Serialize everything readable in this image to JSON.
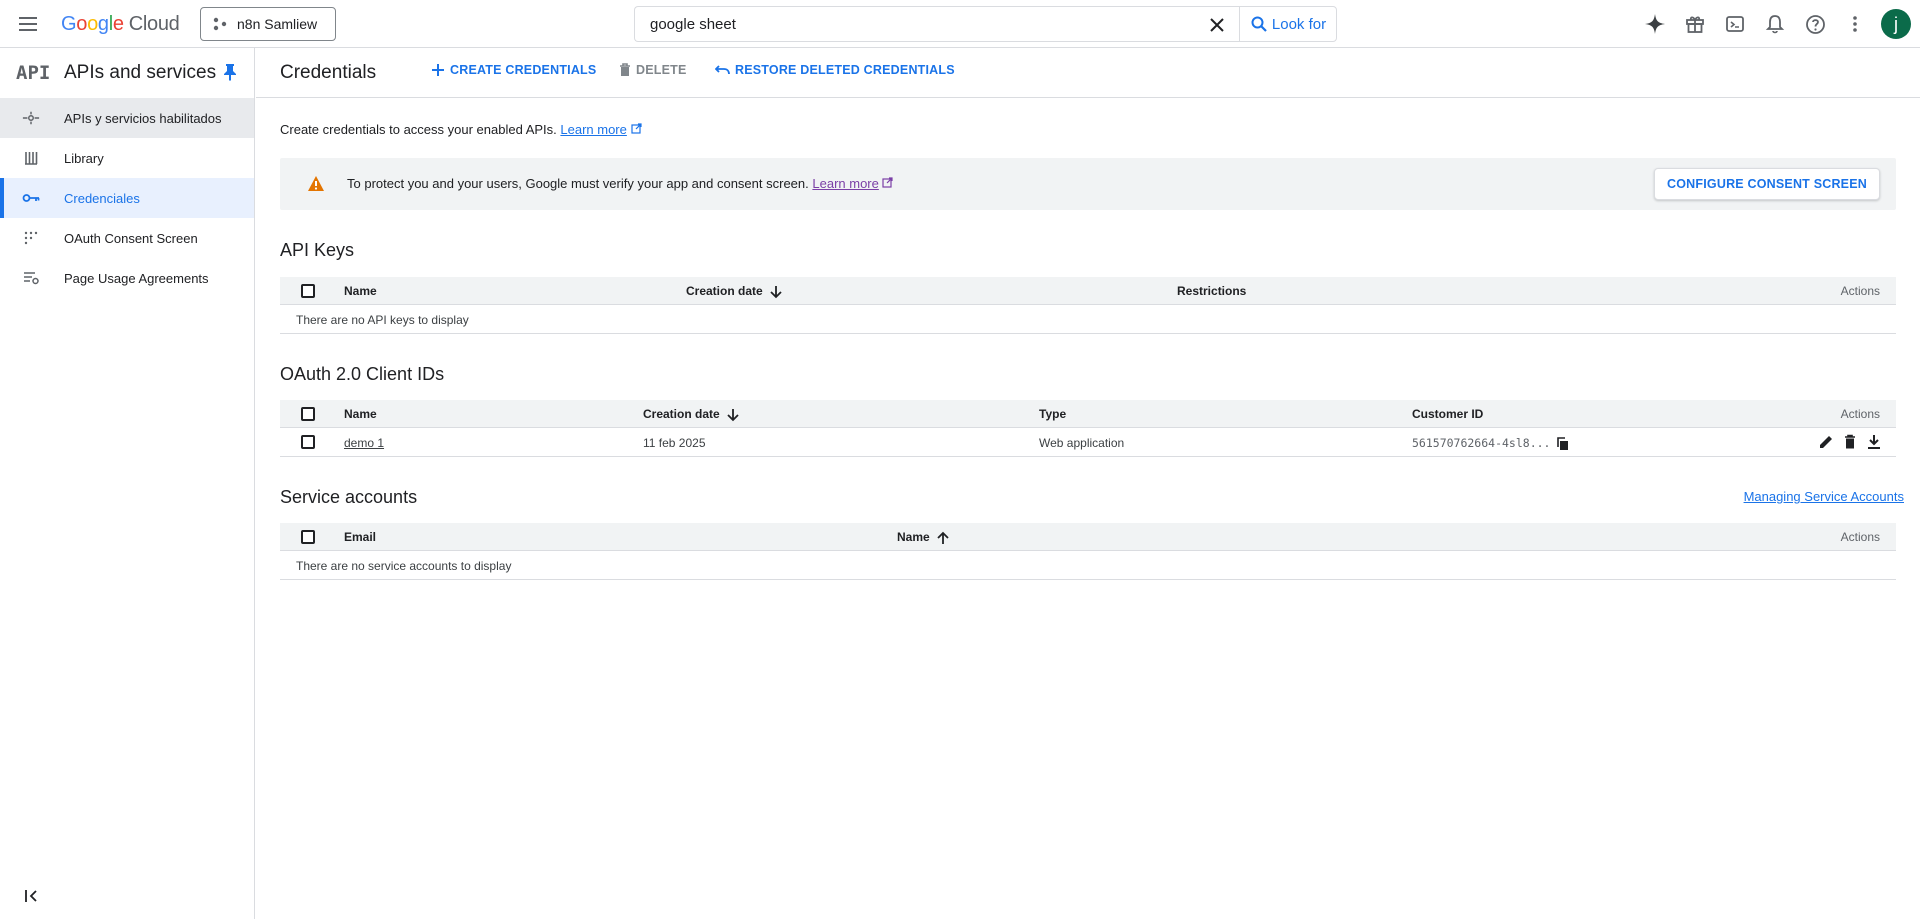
{
  "topbar": {
    "logo_google": [
      "G",
      "o",
      "o",
      "g",
      "l",
      "e"
    ],
    "logo_cloud": "Cloud",
    "project_name": "n8n Samliew",
    "search_value": "google sheet",
    "search_button": "Look for",
    "avatar_letter": "j",
    "icons": [
      "gemini-icon",
      "gift-icon",
      "cloud-shell-icon",
      "notifications-icon",
      "help-icon",
      "more-vert-icon"
    ]
  },
  "sidebar": {
    "logo": "API",
    "title": "APIs and services",
    "items": [
      {
        "label": "APIs y servicios habilitados",
        "icon": "dashboard-icon",
        "state": "hover"
      },
      {
        "label": "Library",
        "icon": "library-icon",
        "state": ""
      },
      {
        "label": "Credenciales",
        "icon": "key-icon",
        "state": "active"
      },
      {
        "label": "OAuth Consent Screen",
        "icon": "consent-icon",
        "state": ""
      },
      {
        "label": "Page Usage Agreements",
        "icon": "agreements-icon",
        "state": ""
      }
    ]
  },
  "header": {
    "title": "Credentials",
    "create": "CREATE CREDENTIALS",
    "delete": "DELETE",
    "restore": "RESTORE DELETED CREDENTIALS"
  },
  "intro": {
    "text": "Create credentials to access your enabled APIs.",
    "link": "Learn more"
  },
  "banner": {
    "text": "To protect you and your users, Google must verify your app and consent screen.",
    "link": "Learn more",
    "button": "CONFIGURE CONSENT SCREEN"
  },
  "api_keys": {
    "title": "API Keys",
    "columns": {
      "name": "Name",
      "created": "Creation date",
      "restrictions": "Restrictions",
      "actions": "Actions"
    },
    "empty": "There are no API keys to display"
  },
  "oauth": {
    "title": "OAuth 2.0 Client IDs",
    "columns": {
      "name": "Name",
      "created": "Creation date",
      "type": "Type",
      "client_id": "Customer ID",
      "actions": "Actions"
    },
    "rows": [
      {
        "name": "demo 1",
        "created": "11 feb 2025",
        "type": "Web application",
        "client_id": "561570762664-4sl8..."
      }
    ]
  },
  "service_accounts": {
    "title": "Service accounts",
    "manage_link": "Managing Service Accounts",
    "columns": {
      "email": "Email",
      "name": "Name",
      "actions": "Actions"
    },
    "empty": "There are no service accounts to display"
  },
  "colors": {
    "accent": "#1a73e8",
    "warning": "#e37400",
    "avatar": "#0b6b4a"
  }
}
